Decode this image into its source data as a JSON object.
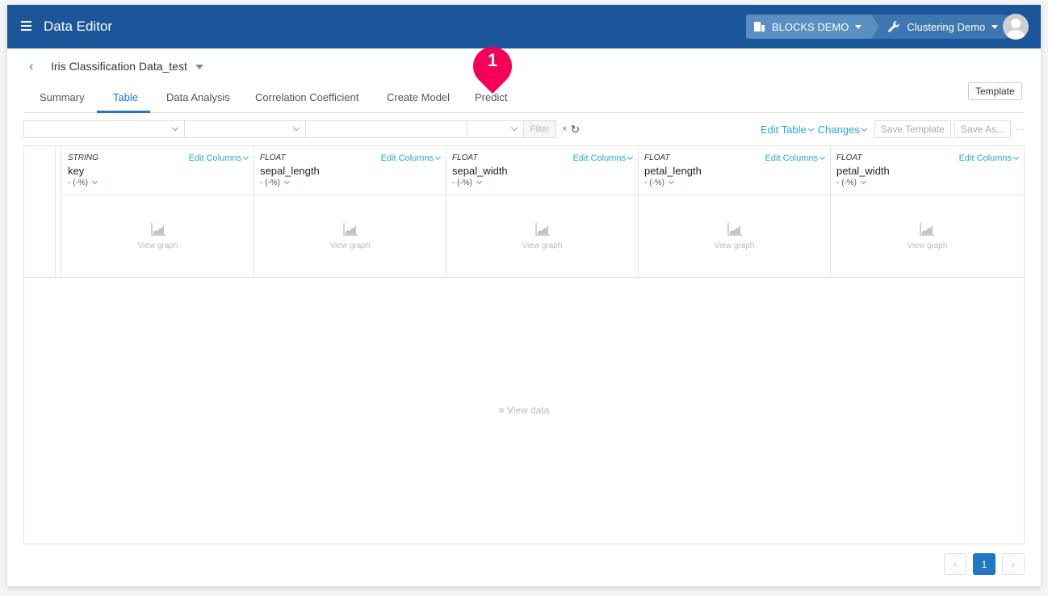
{
  "header": {
    "app_title": "Data Editor",
    "org_label": "BLOCKS DEMO",
    "project_label": "Clustering Demo"
  },
  "dataset": {
    "title": "Iris Classification Data_test"
  },
  "tabs": [
    {
      "label": "Summary",
      "active": false
    },
    {
      "label": "Table",
      "active": true
    },
    {
      "label": "Data Analysis",
      "active": false
    },
    {
      "label": "Correlation Coefficient",
      "active": false
    },
    {
      "label": "Create Model",
      "active": false
    },
    {
      "label": "Predict",
      "active": false
    }
  ],
  "callout_badge": "1",
  "template_button": "Template",
  "filter": {
    "field1_value": "",
    "field2_value": "",
    "text_value": "",
    "field4_value": "",
    "filter_button": "Filter",
    "clear_label": "×",
    "refresh_label": "↻"
  },
  "actions": {
    "edit_table": "Edit Table",
    "changes": "Changes",
    "save_template": "Save Template",
    "save_as": "Save As...",
    "more": "···"
  },
  "columns": [
    {
      "type": "STRING",
      "name": "key",
      "stat": "- (-%)",
      "edit_label": "Edit Columns",
      "graph_label": "View graph"
    },
    {
      "type": "FLOAT",
      "name": "sepal_length",
      "stat": "- (-%)",
      "edit_label": "Edit Columns",
      "graph_label": "View graph"
    },
    {
      "type": "FLOAT",
      "name": "sepal_width",
      "stat": "- (-%)",
      "edit_label": "Edit Columns",
      "graph_label": "View graph"
    },
    {
      "type": "FLOAT",
      "name": "petal_length",
      "stat": "- (-%)",
      "edit_label": "Edit Columns",
      "graph_label": "View graph"
    },
    {
      "type": "FLOAT",
      "name": "petal_width",
      "stat": "- (-%)",
      "edit_label": "Edit Columns",
      "graph_label": "View graph"
    }
  ],
  "view_data_label": "≡ View data",
  "pagination": {
    "prev": "‹",
    "current": "1",
    "next": "›"
  },
  "colors": {
    "header_bg": "#1a5699",
    "accent": "#1f78c1",
    "link": "#2aa6e0",
    "badge": "#f50058"
  }
}
